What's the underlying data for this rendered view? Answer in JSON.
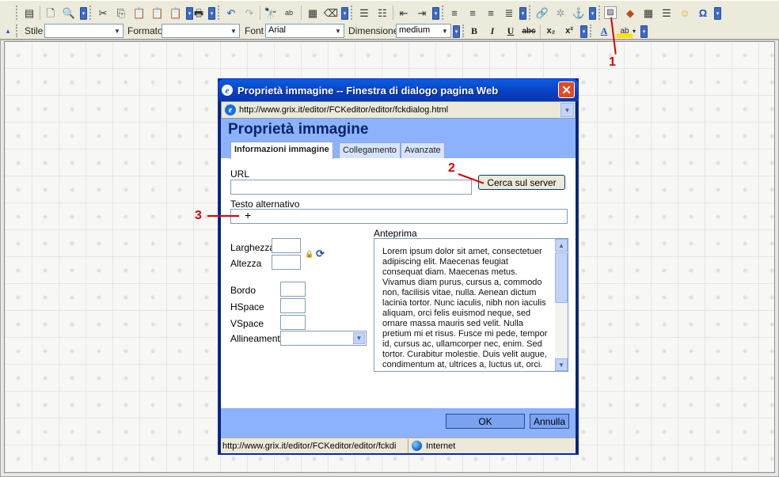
{
  "toolbar1": {
    "icons": [
      "source-icon",
      "new-page-icon",
      "preview-icon",
      "cut-icon",
      "copy-icon",
      "paste-icon",
      "paste-text-icon",
      "paste-word-icon",
      "print-icon",
      "undo-icon",
      "redo-icon",
      "find-icon",
      "replace-icon",
      "select-all-icon",
      "remove-format-icon",
      "numbered-list-icon",
      "bulleted-list-icon",
      "outdent-icon",
      "indent-icon",
      "align-left-icon",
      "align-center-icon",
      "align-right-icon",
      "justify-icon",
      "link-icon",
      "unlink-icon",
      "anchor-icon",
      "image-icon",
      "flash-icon",
      "table-icon",
      "horizontal-rule-icon",
      "smiley-icon",
      "special-char-icon"
    ]
  },
  "toolbar2": {
    "style_label": "Stile",
    "style_value": "",
    "format_label": "Formato",
    "format_value": "",
    "font_label": "Font",
    "font_value": "Arial",
    "size_label": "Dimensione",
    "size_value": "medium",
    "bold": "B",
    "italic": "I",
    "underline": "U",
    "strike": "abc",
    "subscript": "x₂",
    "superscript": "x²",
    "text_color": "A",
    "bg_color": "ab"
  },
  "callouts": {
    "one": "1",
    "two": "2",
    "three": "3"
  },
  "dialog": {
    "title": "Proprietà immagine -- Finestra di dialogo pagina Web",
    "address": "http://www.grix.it/editor/FCKeditor/editor/fckdialog.html",
    "heading": "Proprietà immagine",
    "tabs": [
      "Informazioni immagine",
      "Collegamento",
      "Avanzate"
    ],
    "url_label": "URL",
    "url_value": "",
    "browse_button": "Cerca sul server",
    "alt_label": "Testo alternativo",
    "alt_value": "",
    "width_label": "Larghezza",
    "height_label": "Altezza",
    "border_label": "Bordo",
    "hspace_label": "HSpace",
    "vspace_label": "VSpace",
    "align_label": "Allineamento",
    "align_value": "",
    "preview_label": "Anteprima",
    "preview_text": "Lorem ipsum dolor sit amet, consectetuer adipiscing elit. Maecenas feugiat consequat diam. Maecenas metus. Vivamus diam purus, cursus a, commodo non, facilisis vitae, nulla. Aenean dictum lacinia tortor. Nunc iaculis, nibh non iaculis aliquam, orci felis euismod neque, sed ornare massa mauris sed velit. Nulla pretium mi et risus. Fusce mi pede, tempor id, cursus ac, ullamcorper nec, enim. Sed tortor. Curabitur molestie. Duis velit augue, condimentum at, ultrices a, luctus ut, orci.",
    "ok_button": "OK",
    "cancel_button": "Annulla",
    "status_url": "http://www.grix.it/editor/FCKeditor/editor/fckdi",
    "status_zone": "Internet"
  },
  "colors": {
    "title_bar": "#0a3fc0",
    "dialog_header": "#8cb2fd",
    "callout": "#dd0000"
  }
}
